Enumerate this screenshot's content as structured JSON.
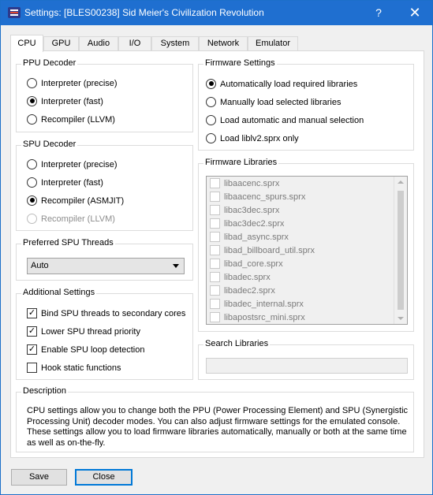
{
  "window": {
    "title": "Settings: [BLES00238] Sid Meier's Civilization Revolution",
    "help_glyph": "?",
    "close_glyph": "✕"
  },
  "tabs": [
    "CPU",
    "GPU",
    "Audio",
    "I/O",
    "System",
    "Network",
    "Emulator"
  ],
  "active_tab": "CPU",
  "ppu_decoder": {
    "title": "PPU Decoder",
    "options": [
      {
        "label": "Interpreter (precise)",
        "selected": false
      },
      {
        "label": "Interpreter (fast)",
        "selected": true
      },
      {
        "label": "Recompiler (LLVM)",
        "selected": false
      }
    ]
  },
  "spu_decoder": {
    "title": "SPU Decoder",
    "options": [
      {
        "label": "Interpreter (precise)",
        "selected": false
      },
      {
        "label": "Interpreter (fast)",
        "selected": false
      },
      {
        "label": "Recompiler (ASMJIT)",
        "selected": true
      },
      {
        "label": "Recompiler (LLVM)",
        "selected": false,
        "disabled": true
      }
    ]
  },
  "spu_threads": {
    "title": "Preferred SPU Threads",
    "value": "Auto"
  },
  "additional": {
    "title": "Additional Settings",
    "options": [
      {
        "label": "Bind SPU threads to secondary cores",
        "checked": true
      },
      {
        "label": "Lower SPU thread priority",
        "checked": true
      },
      {
        "label": "Enable SPU loop detection",
        "checked": true
      },
      {
        "label": "Hook static functions",
        "checked": false
      }
    ]
  },
  "firmware_settings": {
    "title": "Firmware Settings",
    "options": [
      {
        "label": "Automatically load required libraries",
        "selected": true
      },
      {
        "label": "Manually load selected libraries",
        "selected": false
      },
      {
        "label": "Load automatic and manual selection",
        "selected": false
      },
      {
        "label": "Load liblv2.sprx only",
        "selected": false
      }
    ]
  },
  "firmware_libraries": {
    "title": "Firmware Libraries",
    "items": [
      "libaacenc.sprx",
      "libaacenc_spurs.sprx",
      "libac3dec.sprx",
      "libac3dec2.sprx",
      "libad_async.sprx",
      "libad_billboard_util.sprx",
      "libad_core.sprx",
      "libadec.sprx",
      "libadec2.sprx",
      "libadec_internal.sprx",
      "libapostsrc_mini.sprx"
    ]
  },
  "search_libraries": {
    "title": "Search Libraries",
    "value": ""
  },
  "description": {
    "title": "Description",
    "lines": [
      "CPU settings allow you to change both the PPU (Power Processing Element) and SPU (Synergistic",
      "Processing Unit) decoder modes. You can also adjust firmware settings for the emulated console.",
      "These settings allow you to load firmware libraries automatically, manually or both at the same time",
      "as well as on-the-fly."
    ]
  },
  "buttons": {
    "save": "Save",
    "close": "Close"
  },
  "colors": {
    "titlebar": "#1f6fd0",
    "focus_border": "#0078d7"
  }
}
